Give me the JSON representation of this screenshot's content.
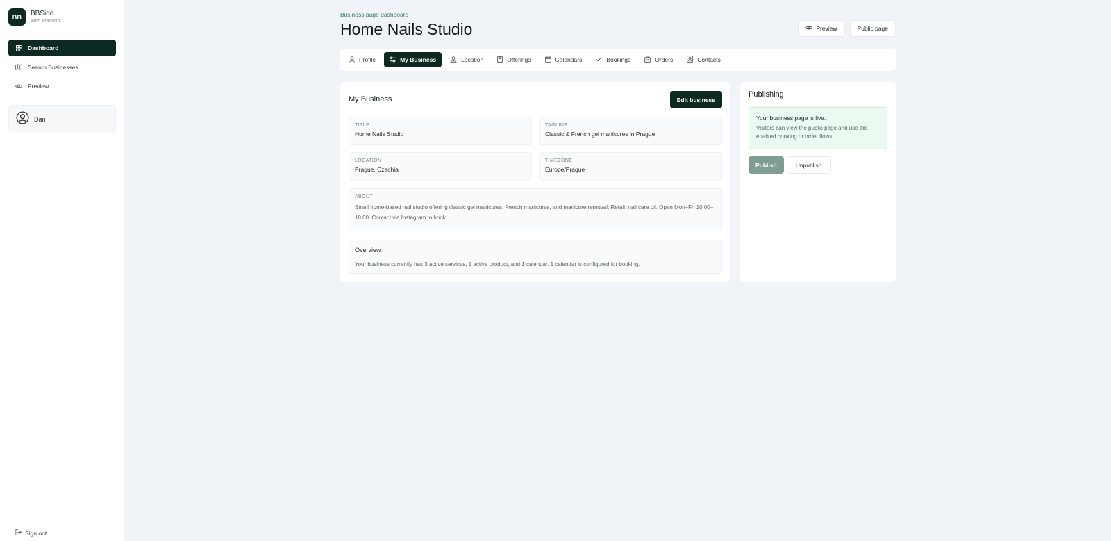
{
  "brand": {
    "logo": "BB",
    "name": "BBSide",
    "subtitle": "Web Platform"
  },
  "sidebar": {
    "items": [
      {
        "label": "Dashboard",
        "icon": "grid-icon",
        "active": true
      },
      {
        "label": "Search Businesses",
        "icon": "map-icon"
      },
      {
        "label": "Preview",
        "icon": "eye-icon"
      }
    ],
    "user": {
      "name": "Dan",
      "icon": "user-circle-icon"
    },
    "signout": "Sign out"
  },
  "header": {
    "eyebrow": "Business page dashboard",
    "title": "Home Nails Studio",
    "preview_label": "Preview",
    "public_label": "Public page"
  },
  "tabs": [
    {
      "label": "Profile",
      "icon": "user-icon"
    },
    {
      "label": "My Business",
      "icon": "sliders-icon",
      "active": true
    },
    {
      "label": "Location",
      "icon": "location-icon"
    },
    {
      "label": "Offerings",
      "icon": "clipboard-icon"
    },
    {
      "label": "Calendars",
      "icon": "calendar-icon"
    },
    {
      "label": "Bookings",
      "icon": "check-icon"
    },
    {
      "label": "Orders",
      "icon": "bag-icon"
    },
    {
      "label": "Contacts",
      "icon": "contact-icon"
    }
  ],
  "business": {
    "card_title": "My Business",
    "edit_label": "Edit business",
    "title_label": "TITLE",
    "title_value": "Home Nails Studio",
    "tagline_label": "TAGLINE",
    "tagline_value": "Classic & French gel manicures in Prague",
    "location_label": "LOCATION",
    "location_value": "Prague, Czechia",
    "timezone_label": "TIMEZONE",
    "timezone_value": "Europe/Prague",
    "about_label": "ABOUT",
    "about_value": "Small home-based nail studio offering classic gel manicures, French manicures, and manicure removal. Retail: nail care oil. Open Mon–Fri 10:00–18:00. Contact via Instagram to book.",
    "overview_title": "Overview",
    "overview_text": "Your business currently has 3 active services, 1 active product, and 1 calendar. 1 calendar is configured for booking."
  },
  "publishing": {
    "title": "Publishing",
    "live_title": "Your business page is live.",
    "live_text": "Visitors can view the public page and use the enabled booking or order flows.",
    "publish_label": "Publish",
    "unpublish_label": "Unpublish"
  }
}
